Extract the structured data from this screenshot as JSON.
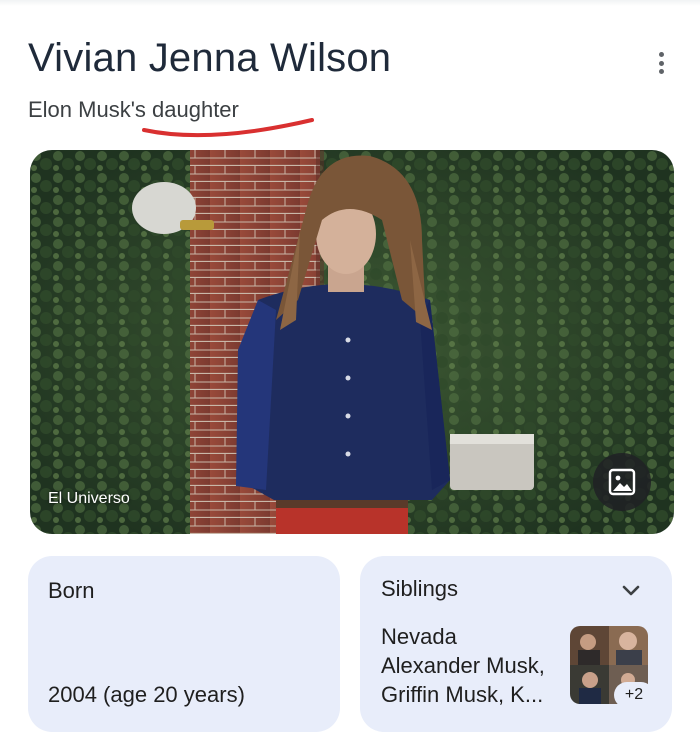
{
  "header": {
    "title": "Vivian Jenna Wilson",
    "subtitle": "Elon Musk's daughter"
  },
  "hero": {
    "source": "El Universo",
    "image_button_icon": "image-icon"
  },
  "born": {
    "label": "Born",
    "value": "2004 (age 20 years)"
  },
  "siblings": {
    "label": "Siblings",
    "lines": [
      "Nevada",
      "Alexander Musk,",
      "Griffin Musk, K..."
    ],
    "more_count": "+2",
    "expand_icon": "chevron-down-icon"
  },
  "colors": {
    "accent_underline": "#d93030",
    "card_bg": "#e8edfa",
    "title": "#1f2a3a"
  }
}
